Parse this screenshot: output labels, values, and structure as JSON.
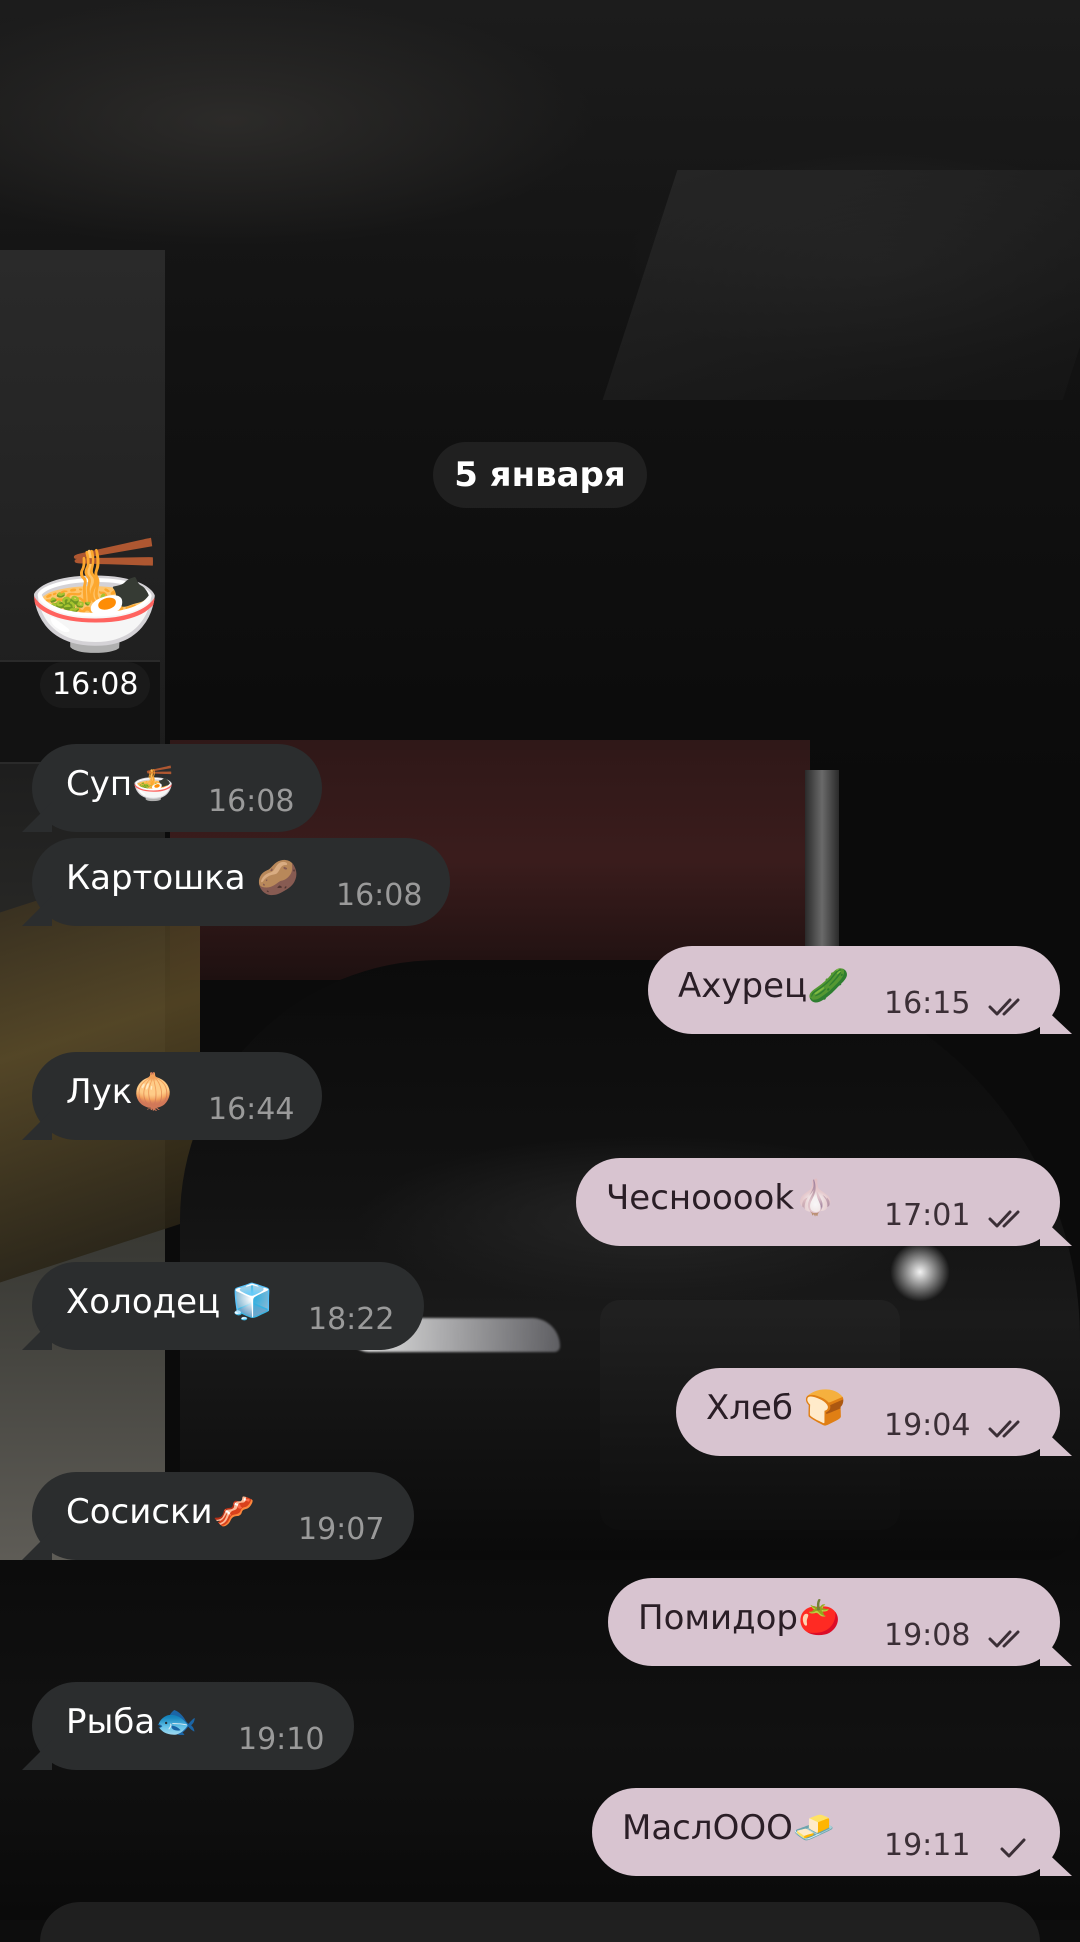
{
  "date_separator": "5 января",
  "sticker": {
    "emoji": "🍜",
    "time": "16:08"
  },
  "messages": [
    {
      "direction": "in",
      "text": "Суп🍜",
      "time": "16:08"
    },
    {
      "direction": "in",
      "text": "Картошка 🥔",
      "time": "16:08"
    },
    {
      "direction": "out",
      "text": "Ахурец🥒",
      "time": "16:15",
      "status": "read"
    },
    {
      "direction": "in",
      "text": "Лук🧅",
      "time": "16:44"
    },
    {
      "direction": "out",
      "text": "Чеснооook🧄",
      "time": "17:01",
      "status": "read"
    },
    {
      "direction": "in",
      "text": "Холодец 🧊",
      "time": "18:22"
    },
    {
      "direction": "out",
      "text": "Хлеб 🍞",
      "time": "19:04",
      "status": "read"
    },
    {
      "direction": "in",
      "text": "Сосиски🥓",
      "time": "19:07"
    },
    {
      "direction": "out",
      "text": "Помидор🍅",
      "time": "19:08",
      "status": "read"
    },
    {
      "direction": "in",
      "text": "Рыба🐟",
      "time": "19:10"
    },
    {
      "direction": "out",
      "text": "МаслOOO🧈",
      "time": "19:11",
      "status": "sent"
    }
  ],
  "colors": {
    "incoming_bubble": "#2b2d2e",
    "outgoing_bubble": "#d8c4d0",
    "incoming_text": "#ffffff",
    "outgoing_text": "#2a1e26"
  },
  "icons": {
    "read": "double-check-icon",
    "sent": "single-check-icon"
  }
}
